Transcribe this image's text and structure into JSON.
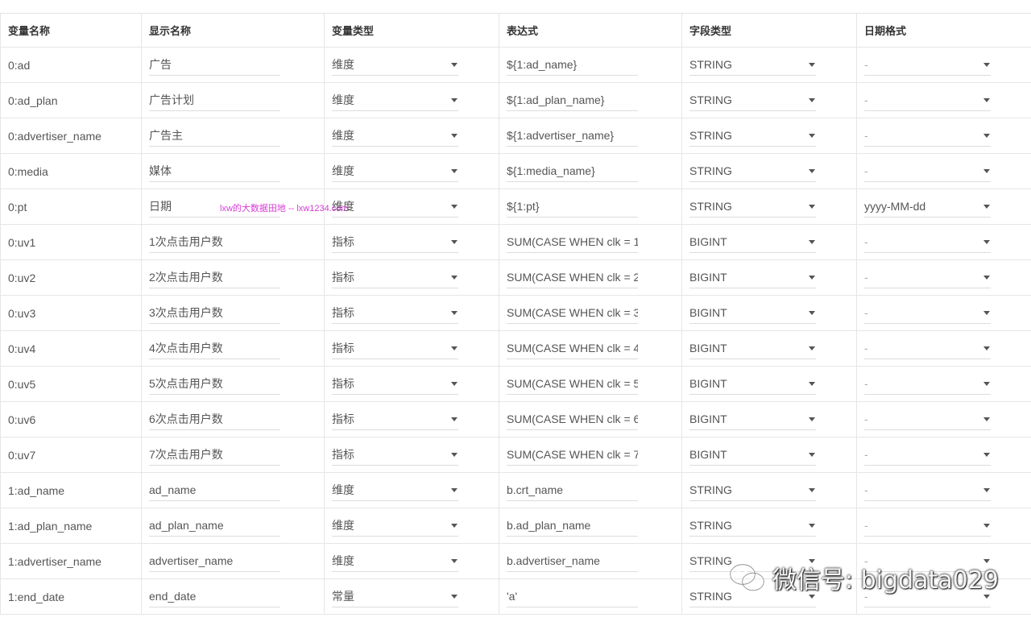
{
  "columns": [
    "变量名称",
    "显示名称",
    "变量类型",
    "表达式",
    "字段类型",
    "日期格式"
  ],
  "rows": [
    {
      "name": "0:ad",
      "display": "广告",
      "vtype": "维度",
      "expr": "${1:ad_name}",
      "ftype": "STRING",
      "date": "-"
    },
    {
      "name": "0:ad_plan",
      "display": "广告计划",
      "vtype": "维度",
      "expr": "${1:ad_plan_name}",
      "ftype": "STRING",
      "date": "-"
    },
    {
      "name": "0:advertiser_name",
      "display": "广告主",
      "vtype": "维度",
      "expr": "${1:advertiser_name}",
      "ftype": "STRING",
      "date": "-"
    },
    {
      "name": "0:media",
      "display": "媒体",
      "vtype": "维度",
      "expr": "${1:media_name}",
      "ftype": "STRING",
      "date": "-"
    },
    {
      "name": "0:pt",
      "display": "日期",
      "vtype": "维度",
      "expr": "${1:pt}",
      "ftype": "STRING",
      "date": "yyyy-MM-dd"
    },
    {
      "name": "0:uv1",
      "display": "1次点击用户数",
      "vtype": "指标",
      "expr": "SUM(CASE WHEN clk = 1",
      "ftype": "BIGINT",
      "date": "-"
    },
    {
      "name": "0:uv2",
      "display": "2次点击用户数",
      "vtype": "指标",
      "expr": "SUM(CASE WHEN clk = 2",
      "ftype": "BIGINT",
      "date": "-"
    },
    {
      "name": "0:uv3",
      "display": "3次点击用户数",
      "vtype": "指标",
      "expr": "SUM(CASE WHEN clk = 3",
      "ftype": "BIGINT",
      "date": "-"
    },
    {
      "name": "0:uv4",
      "display": "4次点击用户数",
      "vtype": "指标",
      "expr": "SUM(CASE WHEN clk = 4",
      "ftype": "BIGINT",
      "date": "-"
    },
    {
      "name": "0:uv5",
      "display": "5次点击用户数",
      "vtype": "指标",
      "expr": "SUM(CASE WHEN clk = 5",
      "ftype": "BIGINT",
      "date": "-"
    },
    {
      "name": "0:uv6",
      "display": "6次点击用户数",
      "vtype": "指标",
      "expr": "SUM(CASE WHEN clk = 6",
      "ftype": "BIGINT",
      "date": "-"
    },
    {
      "name": "0:uv7",
      "display": "7次点击用户数",
      "vtype": "指标",
      "expr": "SUM(CASE WHEN clk = 7",
      "ftype": "BIGINT",
      "date": "-"
    },
    {
      "name": "1:ad_name",
      "display": "ad_name",
      "vtype": "维度",
      "expr": "b.crt_name",
      "ftype": "STRING",
      "date": "-"
    },
    {
      "name": "1:ad_plan_name",
      "display": "ad_plan_name",
      "vtype": "维度",
      "expr": "b.ad_plan_name",
      "ftype": "STRING",
      "date": "-"
    },
    {
      "name": "1:advertiser_name",
      "display": "advertiser_name",
      "vtype": "维度",
      "expr": "b.advertiser_name",
      "ftype": "STRING",
      "date": "-"
    },
    {
      "name": "1:end_date",
      "display": "end_date",
      "vtype": "常量",
      "expr": "'a'",
      "ftype": "STRING",
      "date": "-"
    }
  ],
  "watermark": "lxw的大数据田地 -- lxw1234.com",
  "wechat_label": "微信号: bigdata029",
  "icons": {
    "dropdown": "caret-down-icon",
    "wechat": "wechat-icon"
  }
}
